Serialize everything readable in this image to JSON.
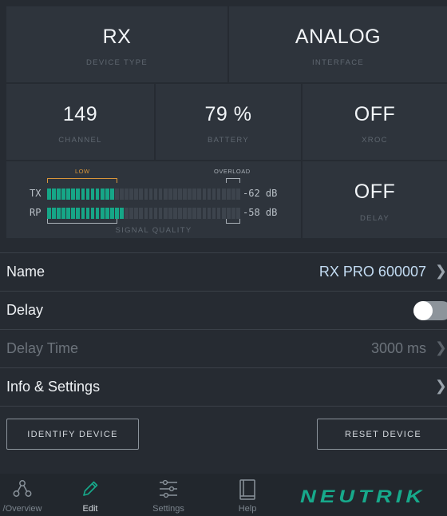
{
  "status": {
    "device_type": {
      "value": "RX",
      "caption": "DEVICE TYPE"
    },
    "interface": {
      "value": "ANALOG",
      "caption": "INTERFACE"
    },
    "channel": {
      "value": "149",
      "caption": "CHANNEL"
    },
    "battery": {
      "value": "79 %",
      "caption": "BATTERY"
    },
    "xroc": {
      "value": "OFF",
      "caption": "XROC"
    },
    "delay": {
      "value": "OFF",
      "caption": "DELAY"
    }
  },
  "signal": {
    "caption": "SIGNAL QUALITY",
    "low_label": "LOW",
    "overload_label": "OVERLOAD",
    "tx": {
      "label": "TX",
      "db": "-62 dB",
      "lit_fraction": 0.36
    },
    "rp": {
      "label": "RP",
      "db": "-58 dB",
      "lit_fraction": 0.4
    },
    "colors": {
      "lit": "#16a687",
      "unlit": "#3d444d",
      "low_bracket": "#d8953a"
    }
  },
  "settings": {
    "name": {
      "label": "Name",
      "value": "RX PRO 600007"
    },
    "delay": {
      "label": "Delay",
      "enabled": false
    },
    "delay_time": {
      "label": "Delay Time",
      "value": "3000 ms"
    },
    "info": {
      "label": "Info & Settings"
    }
  },
  "buttons": {
    "identify": "IDENTIFY DEVICE",
    "reset": "RESET DEVICE"
  },
  "tabs": [
    {
      "label": "/Overview",
      "icon": "network-icon"
    },
    {
      "label": "Edit",
      "icon": "pencil-icon",
      "active": true
    },
    {
      "label": "Settings",
      "icon": "sliders-icon"
    },
    {
      "label": "Help",
      "icon": "book-icon"
    }
  ],
  "brand": {
    "logo": "NEUTRIK",
    "color": "#17a98b"
  }
}
